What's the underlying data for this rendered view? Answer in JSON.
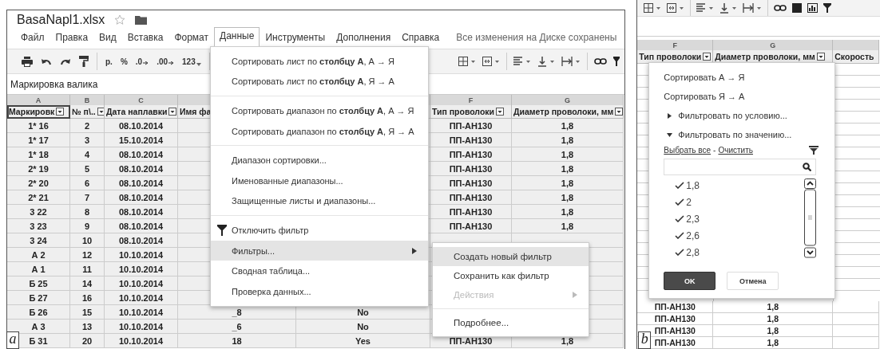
{
  "panel_a": {
    "file_title": "BasaNapl1.xlsx",
    "menu": [
      {
        "label": "Файл",
        "selected": false
      },
      {
        "label": "Правка",
        "selected": false
      },
      {
        "label": "Вид",
        "selected": false
      },
      {
        "label": "Вставка",
        "selected": false
      },
      {
        "label": "Формат",
        "selected": false
      },
      {
        "label": "Данные",
        "selected": true
      },
      {
        "label": "Инструменты",
        "selected": false
      },
      {
        "label": "Дополнения",
        "selected": false
      },
      {
        "label": "Справка",
        "selected": false
      }
    ],
    "save_status": "Все изменения на Диске сохранены",
    "toolbar": [
      "р.",
      "%",
      ".0",
      ".00",
      "123"
    ],
    "formula_bar": "Маркировка валика",
    "columns": [
      {
        "letter": "A",
        "header": "Маркировк",
        "filter": true
      },
      {
        "letter": "B",
        "header": "№ п\\..",
        "filter": true
      },
      {
        "letter": "C",
        "header": "Дата наплавки",
        "filter": true
      },
      {
        "header": "Имя фа"
      },
      {},
      {
        "letter": "F",
        "header": "Тип проволоки",
        "filter": true
      },
      {
        "letter": "G",
        "header": "Диаметр проволоки, мм",
        "filter": true
      }
    ],
    "rows": [
      [
        "1* 16",
        "2",
        "08.10.2014",
        null,
        null,
        "ПП-АН130",
        "1,8"
      ],
      [
        "1* 17",
        "3",
        "15.10.2014",
        null,
        null,
        "ПП-АН130",
        "1,8"
      ],
      [
        "1* 18",
        "4",
        "08.10.2014",
        null,
        null,
        "ПП-АН130",
        "1,8"
      ],
      [
        "2* 19",
        "5",
        "08.10.2014",
        null,
        null,
        "ПП-АН130",
        "1,8"
      ],
      [
        "2* 20",
        "6",
        "08.10.2014",
        null,
        null,
        "ПП-АН130",
        "1,8"
      ],
      [
        "2* 21",
        "7",
        "08.10.2014",
        null,
        null,
        "ПП-АН130",
        "1,8"
      ],
      [
        "3 22",
        "8",
        "08.10.2014",
        null,
        null,
        "ПП-АН130",
        "1,8"
      ],
      [
        "3 23",
        "9",
        "08.10.2014",
        null,
        null,
        "ПП-АН130",
        "1,8"
      ],
      [
        "3 24",
        "10",
        "08.10.2014",
        null,
        null,
        null,
        null
      ],
      [
        "А 2",
        "12",
        "10.10.2014",
        null,
        null,
        null,
        null
      ],
      [
        "А 1",
        "11",
        "10.10.2014",
        null,
        null,
        null,
        null
      ],
      [
        "Б 25",
        "14",
        "10.10.2014",
        null,
        null,
        null,
        null
      ],
      [
        "Б 27",
        "16",
        "10.10.2014",
        null,
        null,
        null,
        null
      ],
      [
        "Б 26",
        "15",
        "10.10.2014",
        "_8",
        "No",
        null,
        null
      ],
      [
        "А 3",
        "13",
        "10.10.2014",
        "_6",
        "No",
        null,
        null
      ],
      [
        "Б 31",
        "20",
        "10.10.2014",
        "18",
        "Yes",
        "ПП-АН130",
        "1,8"
      ]
    ],
    "data_menu": [
      {
        "kind": "item",
        "label": "Сортировать лист по **столбцу А**, А → Я",
        "selected": false,
        "submenu": false
      },
      {
        "kind": "item",
        "label": "Сортировать лист по **столбцу А**, Я → А",
        "selected": false,
        "submenu": false
      },
      {
        "kind": "divider"
      },
      {
        "kind": "item",
        "label": "Сортировать диапазон по **столбцу А**, А → Я",
        "selected": false,
        "submenu": false
      },
      {
        "kind": "item",
        "label": "Сортировать диапазон по **столбцу А**, Я → А",
        "selected": false,
        "submenu": false
      },
      {
        "kind": "divider"
      },
      {
        "kind": "item",
        "label": "Диапазон сортировки...",
        "selected": false,
        "submenu": false
      },
      {
        "kind": "item",
        "label": "Именованные диапазоны...",
        "selected": false,
        "submenu": false
      },
      {
        "kind": "item",
        "label": "Защищенные листы и диапазоны...",
        "selected": false,
        "submenu": false
      },
      {
        "kind": "divider"
      },
      {
        "kind": "icon_item",
        "label": "Отключить фильтр",
        "selected": false,
        "submenu": false
      },
      {
        "kind": "item",
        "label": "Фильтры...",
        "selected": true,
        "submenu": true
      },
      {
        "kind": "item",
        "label": "Сводная таблица...",
        "selected": false,
        "submenu": false
      },
      {
        "kind": "item",
        "label": "Проверка данных...",
        "selected": false,
        "submenu": false
      }
    ],
    "filters_submenu": [
      {
        "kind": "item",
        "label": "Создать новый фильтр",
        "selected": true,
        "disabled": false,
        "submenu": false
      },
      {
        "kind": "item",
        "label": "Сохранить как фильтр",
        "selected": false,
        "disabled": false,
        "submenu": false
      },
      {
        "kind": "item",
        "label": "Действия",
        "selected": false,
        "disabled": true,
        "submenu": true
      },
      {
        "kind": "divider"
      },
      {
        "kind": "item",
        "label": "Подробнее...",
        "selected": false,
        "disabled": false,
        "submenu": false
      }
    ],
    "caption": "a"
  },
  "panel_b": {
    "columns": [
      {
        "letter": "F",
        "header": "Тип проволоки",
        "filter": true
      },
      {
        "letter": "G",
        "header": "Диаметр проволоки, мм",
        "filter": true
      },
      {
        "header": "Скорость"
      }
    ],
    "rows": [
      [
        "ПП-АН130",
        "1,8"
      ],
      [
        "ПП-АН130",
        "1,8"
      ],
      [
        "ПП-АН130",
        "1,8"
      ],
      [
        "ПП-АН130",
        "1,8"
      ]
    ],
    "filter_popup": {
      "sort": [
        "Сортировать А → Я",
        "Сортировать Я → А"
      ],
      "sections": [
        {
          "label": "Фильтровать по условию...",
          "expanded": false
        },
        {
          "label": "Фильтровать по значению...",
          "expanded": true
        }
      ],
      "links": [
        "Выбрать все",
        "Очистить"
      ],
      "link_separator": "-",
      "values": [
        {
          "label": "1,8",
          "checked": true
        },
        {
          "label": "2",
          "checked": true
        },
        {
          "label": "2,3",
          "checked": true
        },
        {
          "label": "2,6",
          "checked": true
        },
        {
          "label": "2,8",
          "checked": true
        }
      ],
      "buttons": [
        {
          "label": "OK",
          "kind": "primary"
        },
        {
          "label": "Отмена",
          "kind": "secondary"
        }
      ]
    },
    "caption": "b"
  }
}
